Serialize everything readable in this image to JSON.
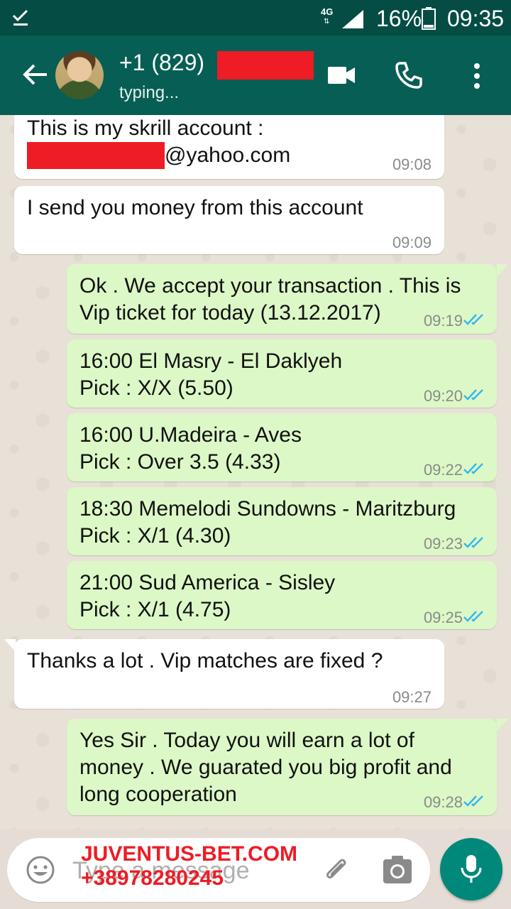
{
  "status_bar": {
    "network": "4G",
    "battery": "16%",
    "time": "09:35"
  },
  "header": {
    "contact": "+1 (829)",
    "status": "typing..."
  },
  "messages": [
    {
      "dir": "in",
      "lines": [
        "This is my skrill account :",
        "@yahoo.com"
      ],
      "time": "09:08"
    },
    {
      "dir": "in",
      "lines": [
        "I send you money from this account"
      ],
      "time": "09:09"
    },
    {
      "dir": "out",
      "lines": [
        "Ok . We accept your transaction . This is",
        "Vip ticket for today (13.12.2017)"
      ],
      "time": "09:19"
    },
    {
      "dir": "out",
      "lines": [
        "16:00 El Masry - El Daklyeh",
        "Pick : X/X (5.50)"
      ],
      "time": "09:20"
    },
    {
      "dir": "out",
      "lines": [
        "16:00 U.Madeira - Aves",
        "Pick : Over 3.5 (4.33)"
      ],
      "time": "09:22"
    },
    {
      "dir": "out",
      "lines": [
        "18:30 Memelodi Sundowns - Maritzburg",
        "Pick : X/1 (4.30)"
      ],
      "time": "09:23"
    },
    {
      "dir": "out",
      "lines": [
        "21:00 Sud America - Sisley",
        "Pick : X/1 (4.75)"
      ],
      "time": "09:25"
    },
    {
      "dir": "in",
      "lines": [
        "Thanks a lot . Vip matches are fixed ?"
      ],
      "time": "09:27"
    },
    {
      "dir": "out",
      "lines": [
        "Yes Sir . Today you will earn a lot of",
        "money . We guarated you big profit and",
        "long cooperation"
      ],
      "time": "09:28"
    }
  ],
  "input": {
    "placeholder": "Type a message"
  },
  "watermark": {
    "line1": "JUVENTUS-BET.COM",
    "line2": "+38978280245"
  },
  "colors": {
    "header": "#075e54",
    "statusbar": "#054d44",
    "out_bubble": "#dcf8c6",
    "in_bubble": "#ffffff",
    "mic": "#00897b",
    "redaction": "#ee1c24"
  },
  "icons": [
    "check-icon",
    "signal-icon",
    "battery-icon",
    "back-arrow-icon",
    "video-call-icon",
    "phone-call-icon",
    "more-vert-icon",
    "emoji-icon",
    "attach-icon",
    "camera-icon",
    "mic-icon",
    "read-ticks-icon"
  ]
}
